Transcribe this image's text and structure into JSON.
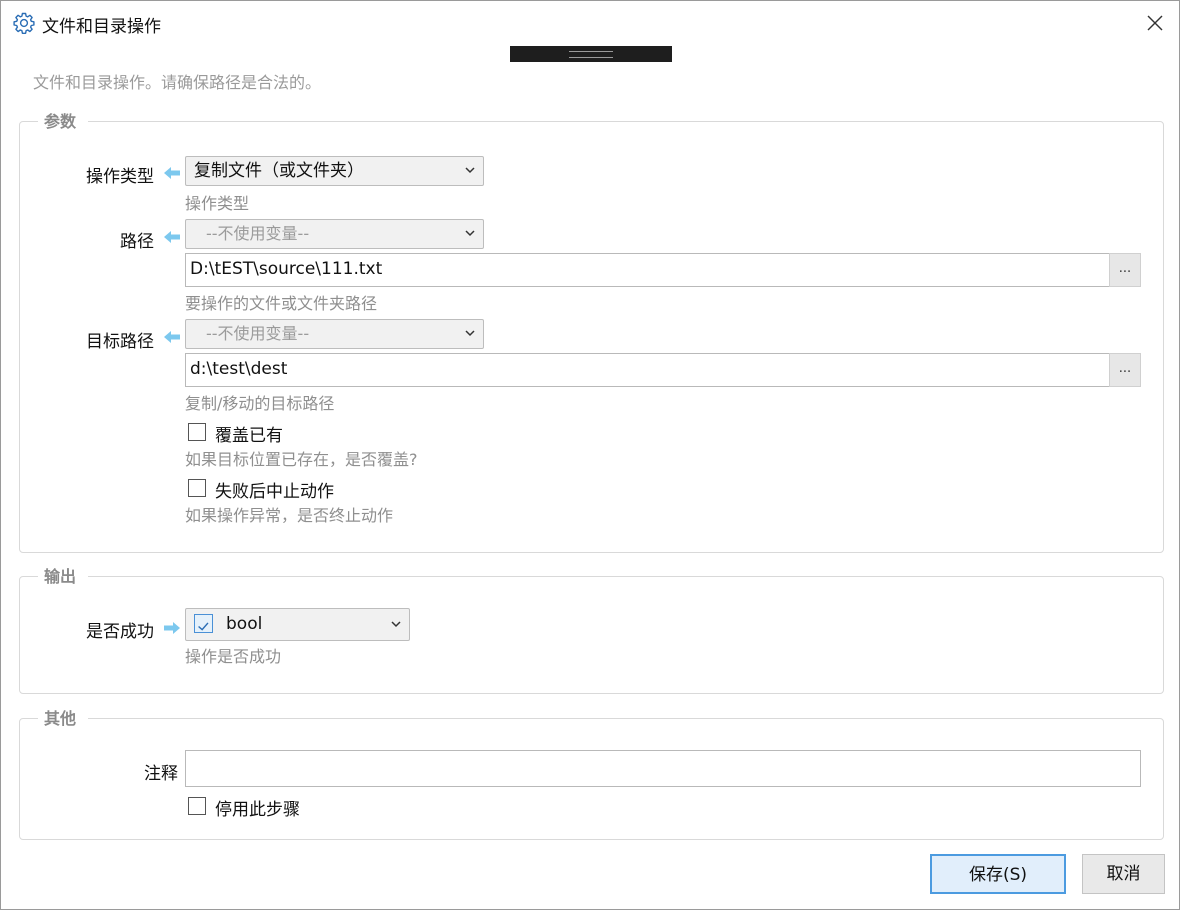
{
  "window": {
    "title": "文件和目录操作",
    "title_icon": "gear-icon"
  },
  "description": "文件和目录操作。请确保路径是合法的。",
  "params": {
    "legend": "参数",
    "operation_type": {
      "label": "操作类型",
      "value": "复制文件（或文件夹）",
      "hint": "操作类型"
    },
    "path": {
      "label": "路径",
      "variable": "--不使用变量--",
      "value": "D:\\tEST\\source\\111.txt",
      "browse": "...",
      "hint": "要操作的文件或文件夹路径"
    },
    "target_path": {
      "label": "目标路径",
      "variable": "--不使用变量--",
      "value": "d:\\test\\dest",
      "browse": "...",
      "hint": "复制/移动的目标路径"
    },
    "overwrite": {
      "label": "覆盖已有",
      "checked": false,
      "hint": "如果目标位置已存在，是否覆盖?"
    },
    "abort_on_fail": {
      "label": "失败后中止动作",
      "checked": false,
      "hint": "如果操作异常，是否终止动作"
    }
  },
  "output": {
    "legend": "输出",
    "success": {
      "label": "是否成功",
      "value": "bool",
      "hint": "操作是否成功"
    }
  },
  "other": {
    "legend": "其他",
    "comment": {
      "label": "注释",
      "value": ""
    },
    "disable_step": {
      "label": "停用此步骤",
      "checked": false
    }
  },
  "buttons": {
    "save": "保存(S)",
    "cancel": "取消"
  },
  "colors": {
    "accent": "#4c9be0",
    "arrow": "#7cc8ee",
    "hint": "#8f8f8f",
    "legend": "#8a8a8a"
  }
}
